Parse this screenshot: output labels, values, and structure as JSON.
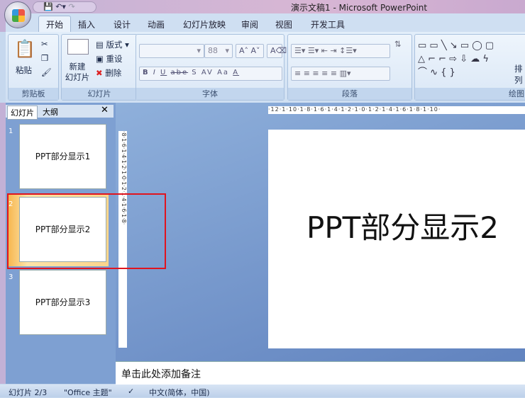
{
  "window": {
    "title": "演示文稿1 - Microsoft PowerPoint"
  },
  "tabs": [
    "开始",
    "插入",
    "设计",
    "动画",
    "幻灯片放映",
    "审阅",
    "视图",
    "开发工具"
  ],
  "ribbon": {
    "clipboard": {
      "label": "剪贴板",
      "paste": "粘贴"
    },
    "slides": {
      "label": "幻灯片",
      "new_slide": "新建\n幻灯片",
      "layout": "版式",
      "reset": "重设",
      "delete": "删除"
    },
    "font": {
      "label": "字体",
      "size": "88",
      "buttons": [
        "B",
        "I",
        "U",
        "abe",
        "S",
        "AV",
        "Aa",
        "A"
      ]
    },
    "paragraph": {
      "label": "段落"
    },
    "drawing": {
      "label": "绘图",
      "arrange": "排列",
      "shapes": "▭ ▭ ╲ ↘ ▭ ◯ ▢ △ ⌐ ⌐ ⇨ ⇩ ☁ ϟ ⌒ ∿ { }"
    }
  },
  "left_pane": {
    "tabs": [
      "幻灯片",
      "大纲"
    ],
    "slides": [
      {
        "num": "1",
        "text": "PPT部分显示1"
      },
      {
        "num": "2",
        "text": "PPT部分显示2"
      },
      {
        "num": "3",
        "text": "PPT部分显示3"
      }
    ]
  },
  "rulers": {
    "h": "·12·1·10·1·8·1·6·1·4·1·2·1·0·1·2·1·4·1·6·1·8·1·10·",
    "v": "·8·1·6·1·4·1·2·1·0·1·2·1·4·1·6·1·8·"
  },
  "slide": {
    "title": "PPT部分显示2"
  },
  "notes": {
    "placeholder": "单击此处添加备注"
  },
  "status": {
    "slide": "幻灯片 2/3",
    "theme": "\"Office 主题\"",
    "language": "中文(简体，中国)"
  },
  "highlight_color": "#e0141e"
}
